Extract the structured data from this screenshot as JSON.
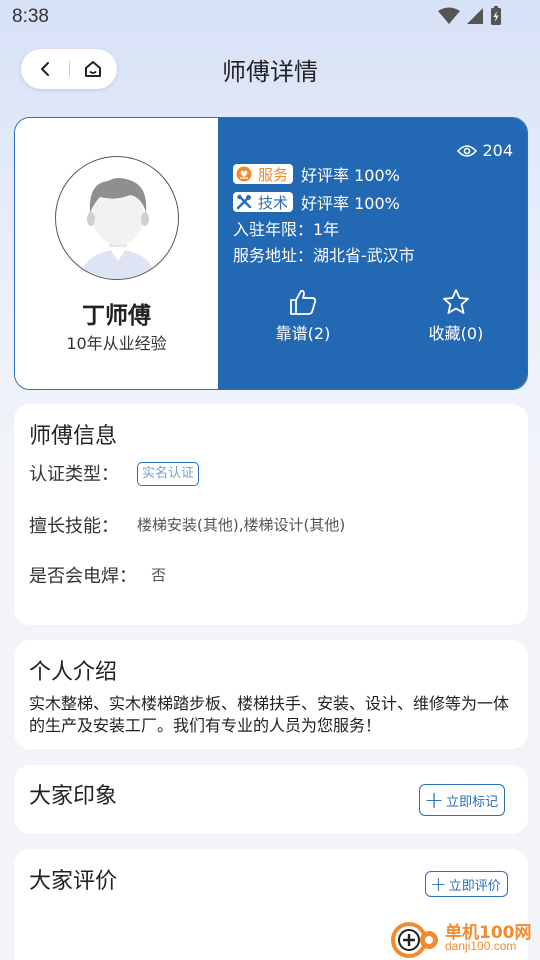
{
  "status_bar": {
    "time": "8:38"
  },
  "header": {
    "title": "师傅详情"
  },
  "profile": {
    "name": "丁师傅",
    "experience": "10年从业经验",
    "views": "204",
    "service_tag": "服务",
    "service_rating": "好评率 100%",
    "tech_tag": "技术",
    "tech_rating": "好评率 100%",
    "years_line": "入驻年限：1年",
    "address_line": "服务地址：湖北省-武汉市",
    "like_label": "靠谱(2)",
    "favorite_label": "收藏(0)"
  },
  "master_info": {
    "title": "师傅信息",
    "cert_label": "认证类型：",
    "cert_badge": "实名认证",
    "skills_label": "擅长技能：",
    "skills_value": "楼梯安装(其他),楼梯设计(其他)",
    "welding_label": "是否会电焊：",
    "welding_value": "否"
  },
  "intro": {
    "title": "个人介绍",
    "text": "实木整梯、实木楼梯踏步板、楼梯扶手、安装、设计、维修等为一体的生产及安装工厂。我们有专业的人员为您服务！"
  },
  "impressions": {
    "title": "大家印象",
    "button": "立即标记"
  },
  "reviews": {
    "title": "大家评价",
    "button": "立即评价"
  },
  "watermark": {
    "name": "单机100网",
    "url": "danji100.com"
  },
  "colors": {
    "accent": "#2368b3",
    "orange": "#f28a2f"
  }
}
